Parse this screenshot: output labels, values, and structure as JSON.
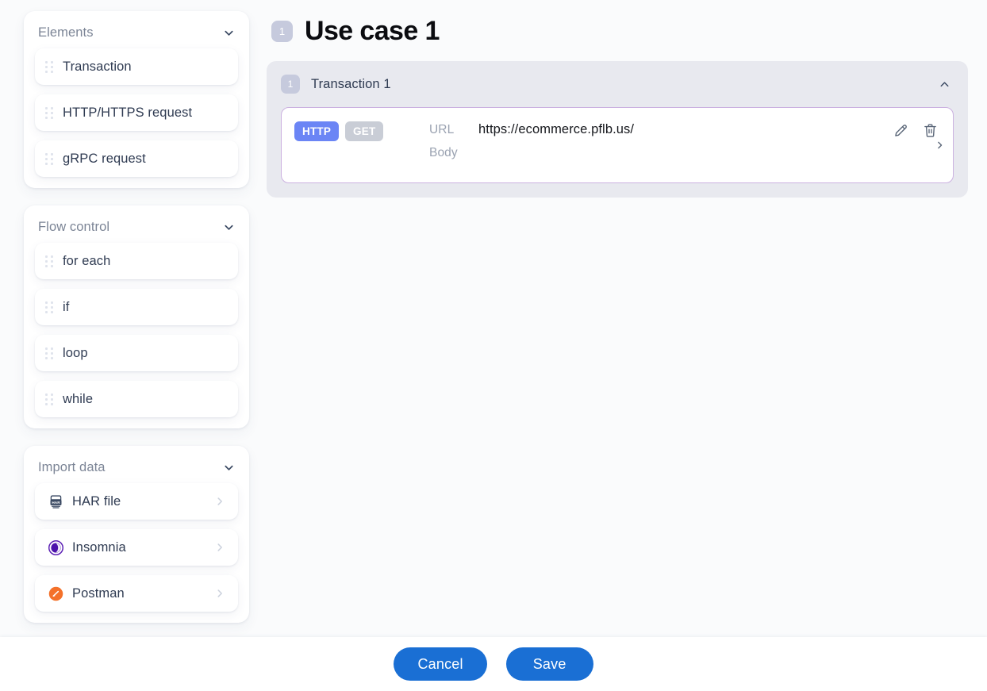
{
  "sidebar": {
    "sections": [
      {
        "title": "Elements",
        "collapse_icon": "chevron-down-icon",
        "items": [
          {
            "label": "Transaction",
            "icon": "drag-handle-icon"
          },
          {
            "label": "HTTP/HTTPS request",
            "icon": "drag-handle-icon"
          },
          {
            "label": "gRPC request",
            "icon": "drag-handle-icon"
          }
        ]
      },
      {
        "title": "Flow control",
        "collapse_icon": "chevron-down-icon",
        "items": [
          {
            "label": "for each",
            "icon": "drag-handle-icon"
          },
          {
            "label": "if",
            "icon": "drag-handle-icon"
          },
          {
            "label": "loop",
            "icon": "drag-handle-icon"
          },
          {
            "label": "while",
            "icon": "drag-handle-icon"
          }
        ]
      },
      {
        "title": "Import data",
        "collapse_icon": "chevron-down-icon",
        "items": [
          {
            "label": "HAR file",
            "icon": "har-file-icon",
            "chevron": "chevron-right-icon"
          },
          {
            "label": "Insomnia",
            "icon": "insomnia-icon",
            "chevron": "chevron-right-icon"
          },
          {
            "label": "Postman",
            "icon": "postman-icon",
            "chevron": "chevron-right-icon"
          }
        ]
      }
    ]
  },
  "main": {
    "page_badge": "1",
    "page_title": "Use case 1",
    "transaction": {
      "badge": "1",
      "title": "Transaction 1",
      "collapse_icon": "chevron-up-icon",
      "request": {
        "protocol_badge": "HTTP",
        "method_badge": "GET",
        "url_label": "URL",
        "url_value": "https://ecommerce.pflb.us/",
        "body_label": "Body",
        "body_value": "",
        "edit_icon": "pencil-icon",
        "delete_icon": "trash-icon",
        "expand_icon": "chevron-right-icon"
      }
    }
  },
  "footer": {
    "cancel_label": "Cancel",
    "save_label": "Save"
  },
  "colors": {
    "page_bg": "#fafbfc",
    "card_bg": "#e8e9ef",
    "accent_blue": "#1a6fd4",
    "http_badge": "#6b85f5",
    "method_badge": "#c9cdd6",
    "badge_gray": "#c6cadd",
    "request_border": "#cbb1e0",
    "insomnia_purple": "#5c21b5",
    "postman_orange": "#f4712a"
  }
}
